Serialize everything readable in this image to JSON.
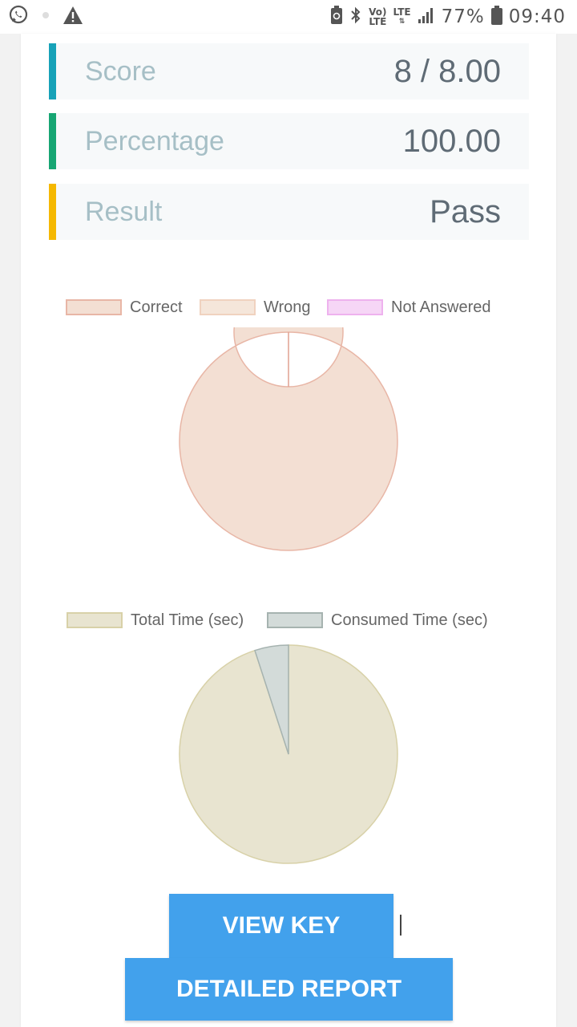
{
  "status_bar": {
    "icons": [
      "whatsapp-icon",
      "warning-icon",
      "battery-saver-icon",
      "bluetooth-icon",
      "signal-icon",
      "battery-icon"
    ],
    "volte_top": "Vo)",
    "volte_bottom": "LTE",
    "lte_label": "LTE",
    "battery_percent": "77%",
    "time": "09:40"
  },
  "stats": [
    {
      "label": "Score",
      "value": "8 / 8.00",
      "accent": "#17a2b8"
    },
    {
      "label": "Percentage",
      "value": "100.00",
      "accent": "#17a673"
    },
    {
      "label": "Result",
      "value": "Pass",
      "accent": "#f5b800"
    }
  ],
  "chart_data": [
    {
      "type": "pie",
      "variant": "doughnut",
      "categories": [
        "Correct",
        "Wrong",
        "Not Answered"
      ],
      "values": [
        8,
        0,
        0
      ],
      "colors": {
        "fill": [
          "#f3dfd3",
          "#f5e6da",
          "#f6d6f6"
        ],
        "stroke": [
          "#e8b6a6",
          "#f0d2bf",
          "#eeb2ee"
        ]
      },
      "legend_position": "top"
    },
    {
      "type": "pie",
      "categories": [
        "Total Time (sec)",
        "Consumed Time (sec)"
      ],
      "values": [
        95,
        5
      ],
      "colors": {
        "fill": [
          "#e8e4d0",
          "#d3dbd9"
        ],
        "stroke": [
          "#d8d1a8",
          "#a6b3b0"
        ]
      },
      "legend_position": "top"
    }
  ],
  "buttons": {
    "view_key": "VIEW KEY",
    "detailed_report": "DETAILED REPORT"
  }
}
